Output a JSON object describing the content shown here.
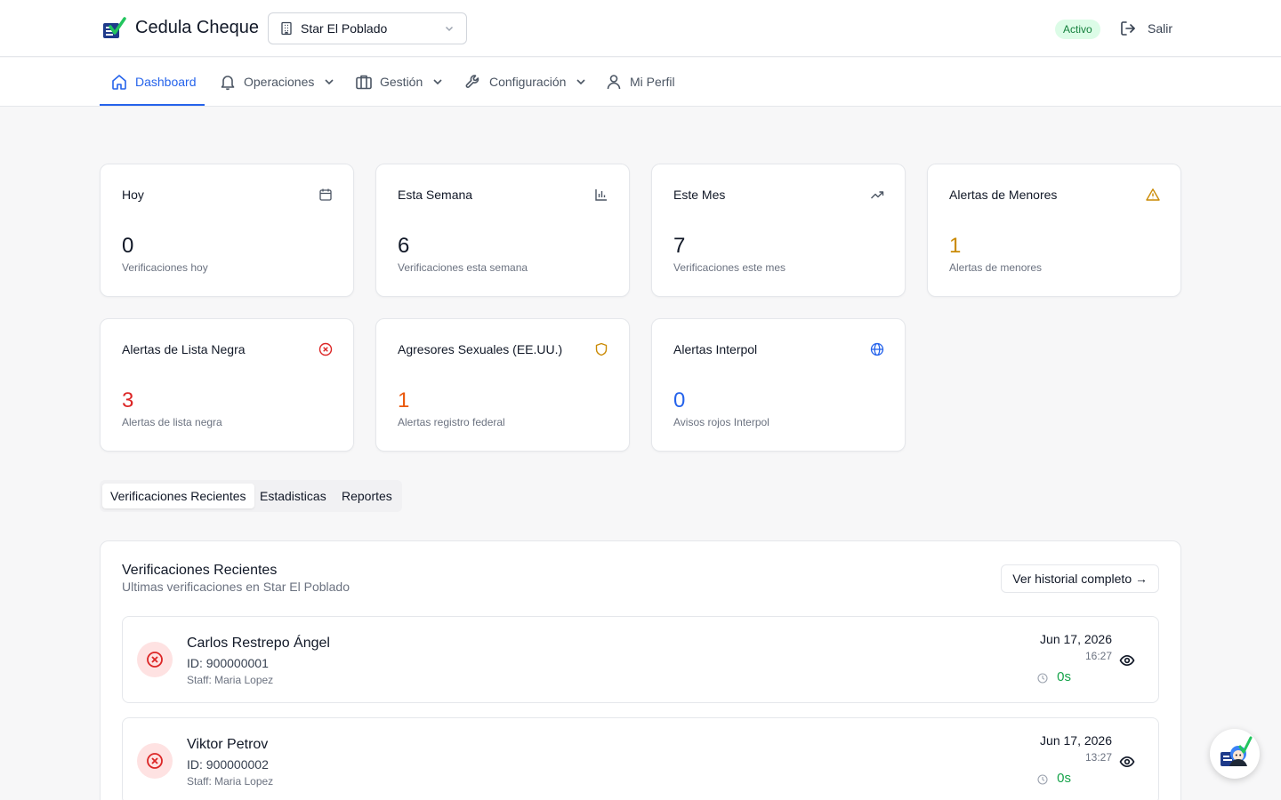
{
  "header": {
    "brand": "Cedula Cheque",
    "branch": "Star El Poblado",
    "status": "Activo",
    "logout_label": "Salir"
  },
  "nav": {
    "items": [
      {
        "label": "Dashboard",
        "icon": "home-icon",
        "active": true
      },
      {
        "label": "Operaciones",
        "icon": "bell-icon",
        "dropdown": true
      },
      {
        "label": "Gestión",
        "icon": "briefcase-icon",
        "dropdown": true
      },
      {
        "label": "Configuración",
        "icon": "wrench-icon",
        "dropdown": true
      },
      {
        "label": "Mi Perfil",
        "icon": "user-icon"
      }
    ]
  },
  "stats": [
    {
      "title": "Hoy",
      "value": "0",
      "desc": "Verificaciones hoy",
      "icon": "calendar-icon",
      "color": "#111827"
    },
    {
      "title": "Esta Semana",
      "value": "6",
      "desc": "Verificaciones esta semana",
      "icon": "bar-chart-icon",
      "color": "#111827"
    },
    {
      "title": "Este Mes",
      "value": "7",
      "desc": "Verificaciones este mes",
      "icon": "trending-up-icon",
      "color": "#111827"
    },
    {
      "title": "Alertas de Menores",
      "value": "1",
      "desc": "Alertas de menores",
      "icon": "warning-icon",
      "color": "#ca8a04"
    },
    {
      "title": "Alertas de Lista Negra",
      "value": "3",
      "desc": "Alertas de lista negra",
      "icon": "x-circle-icon",
      "color": "#dc2626"
    },
    {
      "title": "Agresores Sexuales (EE.UU.)",
      "value": "1",
      "desc": "Alertas registro federal",
      "icon": "shield-icon",
      "color": "#ea580c"
    },
    {
      "title": "Alertas Interpol",
      "value": "0",
      "desc": "Avisos rojos Interpol",
      "icon": "globe-icon",
      "color": "#2563eb"
    }
  ],
  "tabs": [
    {
      "label": "Verificaciones Recientes",
      "active": true
    },
    {
      "label": "Estadisticas"
    },
    {
      "label": "Reportes"
    }
  ],
  "recent": {
    "title": "Verificaciones Recientes",
    "subtitle": "Ultimas verificaciones en Star El Poblado",
    "history_button": "Ver historial completo →",
    "rows": [
      {
        "name": "Carlos Restrepo Ángel",
        "id": "ID: 900000001",
        "staff": "Staff: Maria Lopez",
        "date": "Jun 17, 2026",
        "time": "16:27",
        "duration": "0s"
      },
      {
        "name": "Viktor Petrov",
        "id": "ID: 900000002",
        "staff": "Staff: Maria Lopez",
        "date": "Jun 17, 2026",
        "time": "13:27",
        "duration": "0s"
      }
    ]
  },
  "colors": {
    "accent": "#2563eb",
    "danger": "#dc2626",
    "warning": "#ca8a04",
    "orange": "#ea580c",
    "success": "#16a34a"
  }
}
